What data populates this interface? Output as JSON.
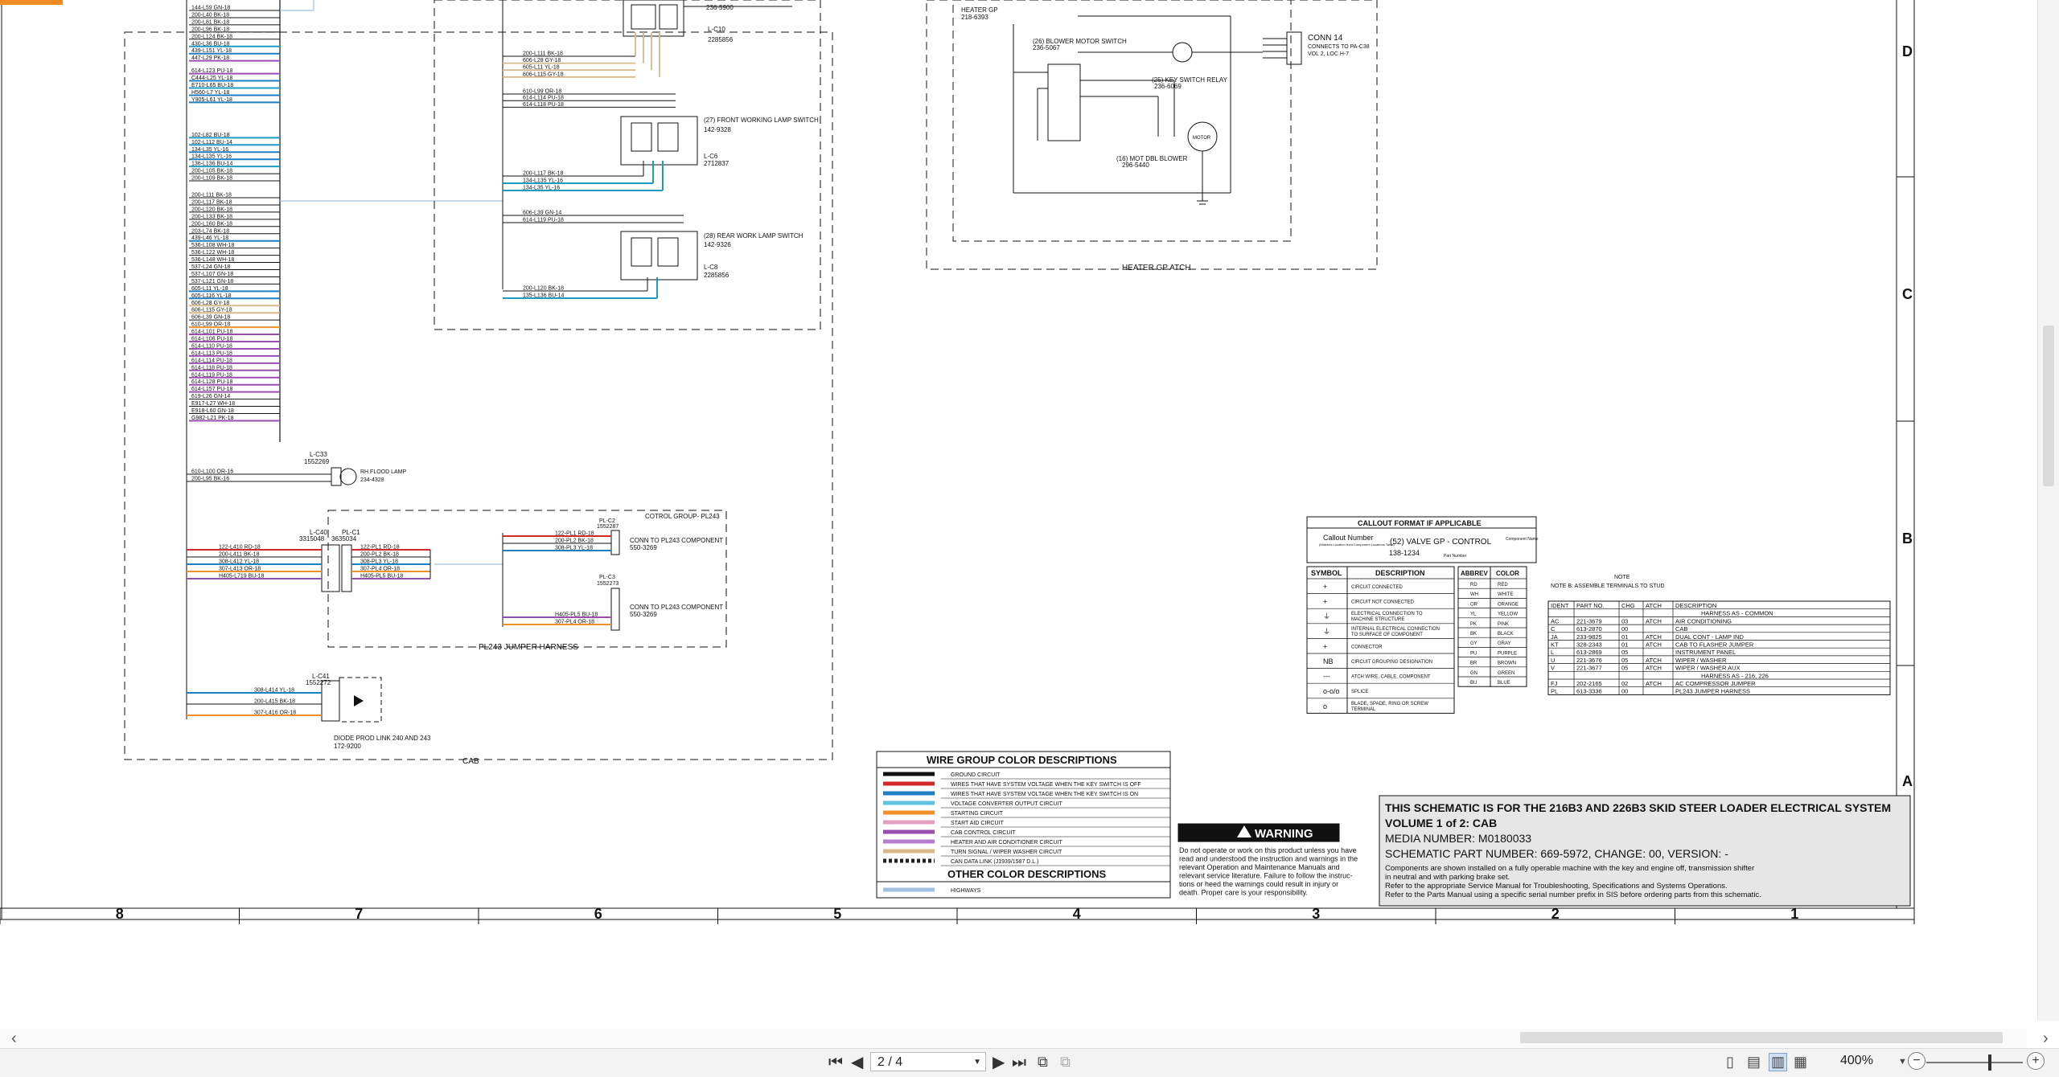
{
  "schematic": {
    "zone_columns": [
      "8",
      "7",
      "6",
      "5",
      "4",
      "3",
      "2",
      "1"
    ],
    "zone_rows": [
      "D",
      "C",
      "B",
      "A"
    ],
    "left_wires": [
      "144-L59 GN-18",
      "200-L40 BK-18",
      "200-L81 BK-18",
      "200-L96 BK-18",
      "200-L124 BK-18",
      "430-L36 BU-18",
      "439-L151 YL-18",
      "447-L29 PK-18",
      "614-L123 PU-18",
      "C444-L25 YL-18",
      "E710-L65 BU-18",
      "H560-L7 YL-18",
      "Y905-L61 YL-18",
      "102-L82 BU-18",
      "102-L112 BU-14",
      "134-L35 YL-16",
      "134-L135 YL-16",
      "136-L136 BU-14",
      "200-L105 BK-18",
      "200-L109 BK-18",
      "200-L111 BK-18",
      "200-L117 BK-18",
      "200-L120 BK-18",
      "200-L133 BK-18",
      "200-L160 BK-18",
      "203-L74 BK-18",
      "439-L46 YL-18",
      "536-L108 WH-18",
      "536-L122 WH-18",
      "536-L148 WH-18",
      "537-L24 GN-18",
      "537-L107 GN-18",
      "537-L121 GN-18",
      "605-L11 YL-18",
      "605-L116 YL-18",
      "606-L28 GY-18",
      "606-L115 GY-18",
      "606-L39 GN-18",
      "610-L99 OR-18",
      "614-L101 PU-18",
      "614-L106 PU-18",
      "614-L110 PU-18",
      "614-L113 PU-18",
      "614-L114 PU-18",
      "614-L118 PU-18",
      "614-L119 PU-18",
      "614-L128 PU-18",
      "614-L157 PU-18",
      "619-L26 GN-14",
      "E917-L27 WH-18",
      "E918-L60 GN-18",
      "G982-L21 PK-18"
    ],
    "top_conn_part": "236-5900",
    "l_c10": "L-C10",
    "l_c10_part": "2285856",
    "c10_wires": [
      "200-L111 BK-18",
      "606-L28 GY-18",
      "605-L11 YL-18",
      "606-L115 GY-18"
    ],
    "c10_wires2": [
      "610-L99 OR-18",
      "614-L114 PU-18",
      "614-L118 PU-18"
    ],
    "front_switch_label": "(27) FRONT WORKING LAMP SWITCH",
    "front_switch_part": "142-9328",
    "l_c6": "L-C6",
    "l_c6_part": "2712837",
    "front_wires": [
      "200-L117 BK-18",
      "134-L135 YL-16",
      "134-L35 YL-16"
    ],
    "rear_wires_top": [
      "606-L39 GN-14",
      "614-L119 PU-18"
    ],
    "rear_switch_label": "(28) REAR WORK LAMP SWITCH",
    "rear_switch_part": "142-9326",
    "l_c8": "L-C8",
    "l_c8_part": "2285856",
    "rear_wires": [
      "200-L120 BK-18",
      "135-L136 BU-14"
    ],
    "l_c33": "L-C33",
    "l_c33_part": "1552269",
    "flood_wires": [
      "610-L100 OR-16",
      "200-L95 BK-16"
    ],
    "flood_label": "RH FLOOD LAMP",
    "flood_part": "234-4328",
    "l_c40": "L-C40",
    "l_c40_part": "3315048",
    "pl_c1": "PL-C1",
    "pl_c1_part": "3635034",
    "jumper_left_wires": [
      "122-L410 RD-18",
      "200-L411 BK-18",
      "308-L412 YL-18",
      "307-L413 OR-18",
      "H405-L719 BU-18"
    ],
    "jumper_mid_wires": [
      "122-PL1 RD-18",
      "200-PL2 BK-18",
      "308-PL3 YL-18",
      "307-PL4 OR-18",
      "H405-PL5 BU-18"
    ],
    "control_group": "COTROL GROUP- PL243",
    "pl_c2": "PL-C2",
    "pl_c2_part": "1552287",
    "pl243_wires_a": [
      "122-PL1 RD-18",
      "200-PL2 BK-18",
      "308-PL3 YL-18"
    ],
    "conn_pl243": "CONN TO PL243 COMPONENT",
    "conn_pl243_part": "550-3269",
    "pl_c3": "PL-C3",
    "pl_c3_part": "1552273",
    "pl243_wires_b": [
      "H405-PL5 BU-18",
      "307-PL4 OR-18"
    ],
    "pl243_harness": "PL243 JUMPER HARNESS",
    "l_c41": "L-C41",
    "l_c41_part": "1552272",
    "diode_wires": [
      "308-L414 YL-18",
      "200-L415 BK-18",
      "307-L416 OR-18"
    ],
    "diode_label": "DIODE PROD LINK 240 AND 243",
    "diode_part": "172-9200",
    "cab_label": "CAB",
    "heater_gp": "HEATER GP",
    "heater_gp_part": "218-6393",
    "blower_switch": "(26) BLOWER MOTOR SWITCH",
    "blower_switch_part": "236-5067",
    "key_relay": "(25) KEY SWITCH RELAY",
    "key_relay_part": "236-6069",
    "mot_blower": "(16) MOT DBL BLOWER",
    "mot_blower_part": "296-5440",
    "motor": "MOTOR",
    "conn14": "CONN 14",
    "conn14_desc1": "CONNECTS TO PA-C38",
    "conn14_desc2": "VOL 2, LOC H-7",
    "heater_atch": "HEATER GP ATCH",
    "callout_title": "CALLOUT FORMAT IF APPLICABLE",
    "callout_number": "Callout Number",
    "callout_number_sub": "(Matches Location from Component Locations Table)",
    "callout_example": "(52) VALVE GP - CONTROL",
    "callout_partno": "138-1234",
    "callout_component_name": "Component Name",
    "callout_part_number": "Part Number",
    "symbol_header": [
      "SYMBOL",
      "DESCRIPTION"
    ],
    "symbols": [
      {
        "sym": "+",
        "desc": "CIRCUIT CONNECTED"
      },
      {
        "sym": "+",
        "desc": "CIRCUIT NOT CONNECTED"
      },
      {
        "sym": "⏚",
        "desc": "ELECTRICAL CONNECTION TO MACHINE STRUCTURE"
      },
      {
        "sym": "⏚",
        "desc": "INTERNAL ELECTRICAL CONNECTION TO SURFACE OF COMPONENT"
      },
      {
        "sym": "+",
        "desc": "CONNECTOR"
      },
      {
        "sym": "NB",
        "desc": "CIRCUIT GROUPING DESIGNATION"
      },
      {
        "sym": "---",
        "desc": "ATCH WIRE, CABLE, COMPONENT"
      },
      {
        "sym": "o-o/o",
        "desc": "SPLICE"
      },
      {
        "sym": "o",
        "desc": "BLADE, SPADE, RING OR SCREW TERMINAL"
      }
    ],
    "abbrev_header": [
      "ABBREV",
      "COLOR"
    ],
    "abbrevs": [
      [
        "RD",
        "RED"
      ],
      [
        "WH",
        "WHITE"
      ],
      [
        "OR",
        "ORANGE"
      ],
      [
        "YL",
        "YELLOW"
      ],
      [
        "PK",
        "PINK"
      ],
      [
        "BK",
        "BLACK"
      ],
      [
        "GY",
        "GRAY"
      ],
      [
        "PU",
        "PURPLE"
      ],
      [
        "BR",
        "BROWN"
      ],
      [
        "GN",
        "GREEN"
      ],
      [
        "BU",
        "BLUE"
      ]
    ],
    "note_title": "NOTE",
    "note_b": "NOTE B:  ASSEMBLE TERMINALS TO STUD",
    "harness_header": [
      "IDENT",
      "PART NO.",
      "CHG",
      "ATCH",
      "DESCRIPTION"
    ],
    "harness_common": "HARNESS AS - COMMON",
    "harness_rows_a": [
      [
        "AC",
        "221-3679",
        "03",
        "ATCH",
        "AIR CONDITIONING"
      ],
      [
        "C",
        "613-2870",
        "00",
        "",
        "CAB"
      ],
      [
        "JA",
        "233-9825",
        "01",
        "ATCH",
        "DUAL CONT - LAMP IND"
      ],
      [
        "KT",
        "328-2343",
        "01",
        "ATCH",
        "CAB TO FLASHER JUMPER"
      ],
      [
        "L",
        "613-2869",
        "05",
        "",
        "INSTRUMENT PANEL"
      ],
      [
        "U",
        "221-3676",
        "05",
        "ATCH",
        "WIPER / WASHER"
      ],
      [
        "V",
        "221-3677",
        "05",
        "ATCH",
        "WIPER / WASHER AUX"
      ]
    ],
    "harness_216": "HARNESS AS - 216, 226",
    "harness_rows_b": [
      [
        "FJ",
        "202-2165",
        "02",
        "ATCH",
        "AC COMPRESSOR JUMPER"
      ],
      [
        "PL",
        "613-3336",
        "00",
        "",
        "PL243 JUMPER HARNESS"
      ]
    ],
    "wire_group_title": "WIRE GROUP COLOR DESCRIPTIONS",
    "wire_groups": [
      {
        "color": "#111111",
        "label": "GROUND CIRCUIT"
      },
      {
        "color": "#d22a2a",
        "label": "WIRES THAT HAVE SYSTEM VOLTAGE WHEN THE KEY SWITCH IS OFF"
      },
      {
        "color": "#1e7fc2",
        "label": "WIRES THAT HAVE SYSTEM VOLTAGE WHEN THE KEY SWITCH IS ON"
      },
      {
        "color": "#5ec4e0",
        "label": "VOLTAGE CONVERTER OUTPUT CIRCUIT"
      },
      {
        "color": "#f0902a",
        "label": "STARTING CIRCUIT"
      },
      {
        "color": "#e3a0c0",
        "label": "START AID CIRCUIT"
      },
      {
        "color": "#9a4fb0",
        "label": "CAB CONTROL CIRCUIT"
      },
      {
        "color": "#b57fd0",
        "label": "HEATER AND AIR CONDITIONER CIRCUIT"
      },
      {
        "color": "#d8b88a",
        "label": "TURN SIGNAL / WIPER WASHER CIRCUIT"
      },
      {
        "color": "#222222",
        "label": "CAN DATA LINK (J1939/1587 D.L.)"
      }
    ],
    "other_color_title": "OTHER COLOR DESCRIPTIONS",
    "other_colors": [
      {
        "color": "#9fc0e0",
        "label": "HIGHWAYS"
      }
    ],
    "warning_title": "WARNING",
    "warning_lines": [
      "Do not operate or work on this product unless you have",
      "read and understood the instruction and warnings in the",
      "relevant Operation and Maintenance Manuals and",
      "relevant service literature. Failure to follow the instruc-",
      "tions or heed the warnings could result in injury or",
      "death. Proper care is your responsibility."
    ],
    "title_line1": "THIS SCHEMATIC IS FOR THE 216B3 AND 226B3 SKID STEER LOADER ELECTRICAL SYSTEM",
    "title_line2": "VOLUME 1 of 2: CAB",
    "media_number": "MEDIA NUMBER: M0180033",
    "schematic_part": "SCHEMATIC PART NUMBER: 669-5972, CHANGE: 00, VERSION: -",
    "title_notes": [
      "Components are shown installed on a fully operable machine with the key and engine off, transmission shifter",
      "in neutral and with parking brake set.",
      "Refer to the appropriate Service Manual for Troubleshooting, Specifications and Systems Operations.",
      "Refer to the Parts Manual using a specific serial number prefix in SIS before ordering parts from this schematic."
    ]
  },
  "toolbar": {
    "page_display": "2 / 4",
    "zoom_level": "400%",
    "first_page": "⏮",
    "prev_page": "◀",
    "next_page": "▶",
    "last_page": "⏭"
  }
}
